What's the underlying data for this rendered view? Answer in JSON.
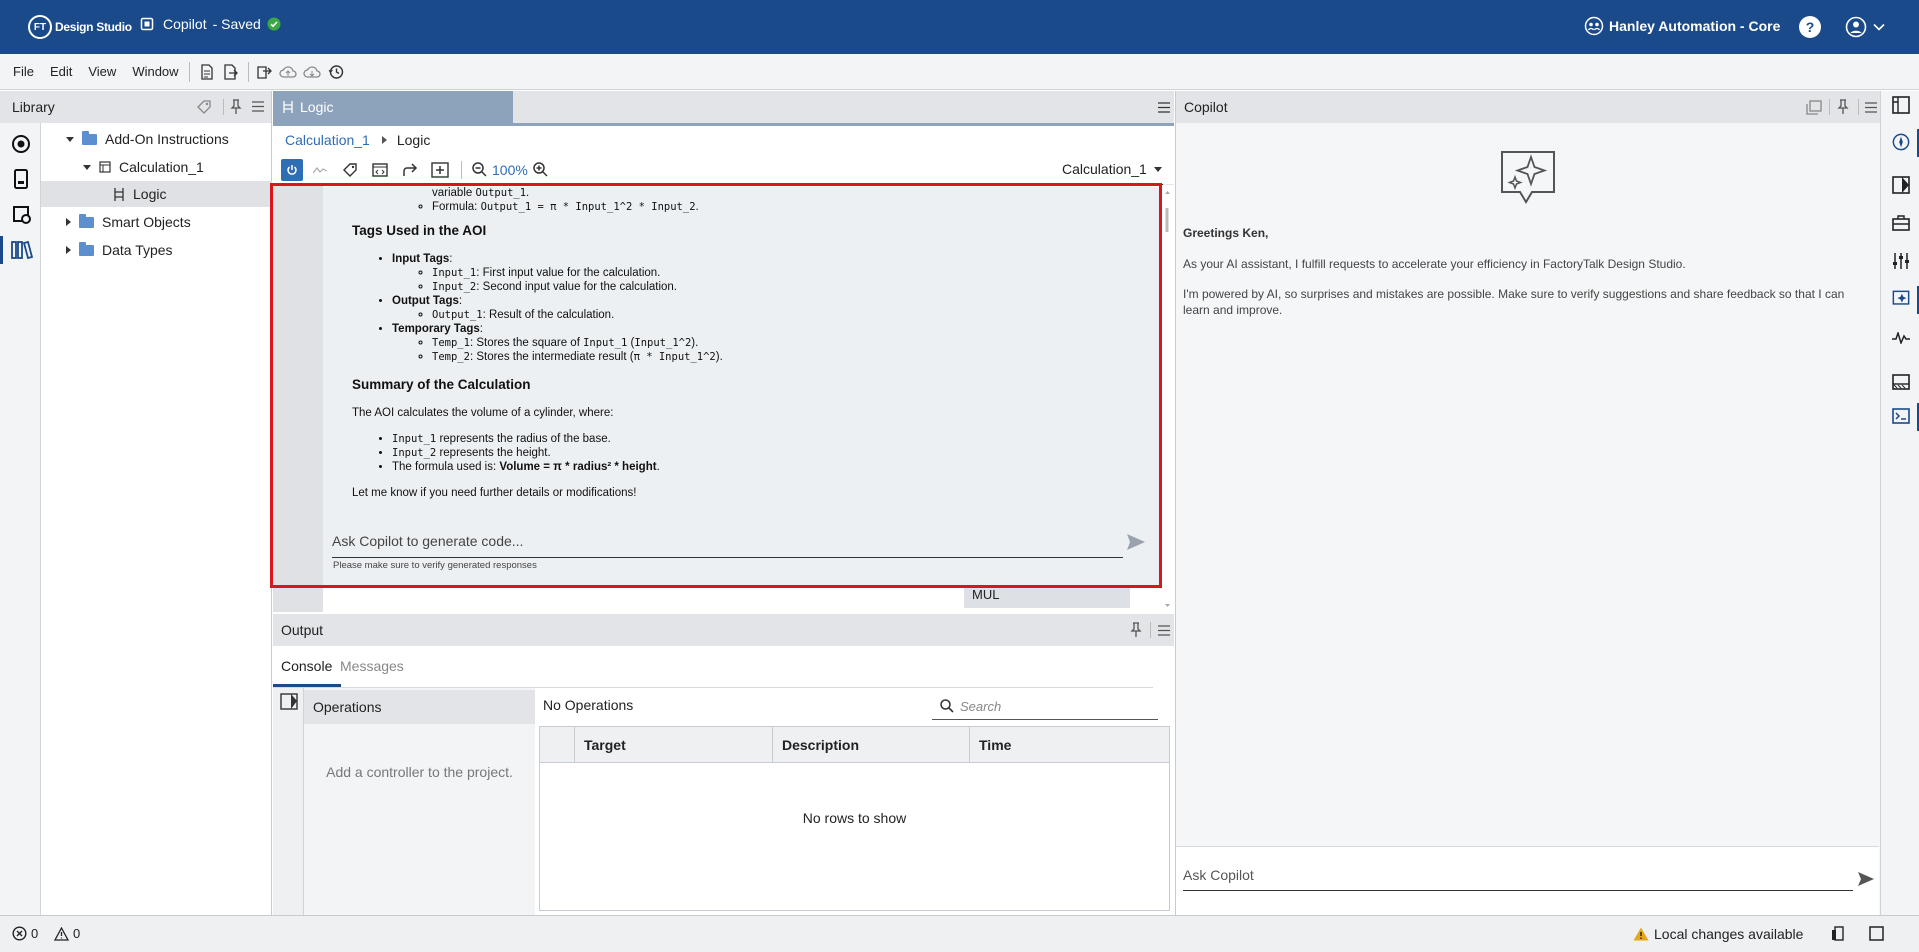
{
  "topbar": {
    "logo_mark": "FT",
    "logo_text": "Design Studio",
    "project_name": "Copilot",
    "save_status": "- Saved",
    "account": "Hanley Automation - Core",
    "help_label": "?"
  },
  "menu": {
    "items": [
      "File",
      "Edit",
      "View",
      "Window"
    ]
  },
  "library": {
    "title": "Library",
    "tree": [
      {
        "label": "Add-On Instructions"
      },
      {
        "label": "Calculation_1"
      },
      {
        "label": "Logic"
      },
      {
        "label": "Smart Objects"
      },
      {
        "label": "Data Types"
      }
    ]
  },
  "logic": {
    "tab_label": "Logic",
    "breadcrumb": [
      "Calculation_1",
      "Logic"
    ],
    "zoom": "100%",
    "routine_select": "Calculation_1",
    "rung_instruction": "MUL"
  },
  "overlay": {
    "top_line1_a": "variable ",
    "top_line1_code": "Output_1",
    "top_line1_b": ".",
    "formula_label": "Formula: ",
    "formula_code": "Output_1 = π * Input_1^2 * Input_2",
    "formula_end": ".",
    "tags_heading": "Tags Used in the AOI",
    "input_tags_label": "Input Tags",
    "input_1_code": "Input_1",
    "input_1_desc": ": First input value for the calculation.",
    "input_2_code": "Input_2",
    "input_2_desc": ": Second input value for the calculation.",
    "output_tags_label": "Output Tags",
    "output_1_code": "Output_1",
    "output_1_desc": ": Result of the calculation.",
    "temp_tags_label": "Temporary Tags",
    "temp_1_code": "Temp_1",
    "temp_1_desc_a": ": Stores the square of ",
    "temp_1_desc_code": "Input_1",
    "temp_1_desc_b": " (",
    "temp_1_desc_code2": "Input_1^2",
    "temp_1_desc_c": ").",
    "temp_2_code": "Temp_2",
    "temp_2_desc_a": ": Stores the intermediate result (",
    "temp_2_desc_code": "π * Input_1^2",
    "temp_2_desc_b": ").",
    "summary_heading": "Summary of the Calculation",
    "summary_intro": "The AOI calculates the volume of a cylinder, where:",
    "summary_1_code": "Input_1",
    "summary_1_text": " represents the radius of the base.",
    "summary_2_code": "Input_2",
    "summary_2_text": " represents the height.",
    "summary_3_text": "The formula used is: ",
    "summary_3_bold": "Volume = π * radius² * height",
    "summary_3_end": ".",
    "closing": "Let me know if you need further details or modifications!",
    "input_placeholder": "Ask Copilot to generate code...",
    "disclaimer": "Please make sure to verify generated responses"
  },
  "output": {
    "title": "Output",
    "tabs": [
      "Console",
      "Messages"
    ],
    "operations_header": "Operations",
    "operations_empty": "Add a controller to the project.",
    "no_operations": "No Operations",
    "search_placeholder": "Search",
    "columns": [
      "Target",
      "Description",
      "Time"
    ],
    "empty_grid": "No rows to show"
  },
  "copilot": {
    "title": "Copilot",
    "greeting": "Greetings Ken,",
    "para1": "As your AI assistant, I fulfill requests to accelerate your efficiency in FactoryTalk Design Studio.",
    "para2": "I'm powered by AI, so surprises and mistakes are possible. Make sure to verify suggestions and share feedback so that I can learn and improve.",
    "input_placeholder": "Ask Copilot"
  },
  "status": {
    "errors": "0",
    "warnings": "0",
    "local_changes": "Local changes available"
  },
  "colors": {
    "brand": "#1a4a8a",
    "accent_blue": "#2f6db5",
    "highlight_red": "#d8171c",
    "saved_green": "#3aa845",
    "warning_yellow": "#e6a817"
  }
}
